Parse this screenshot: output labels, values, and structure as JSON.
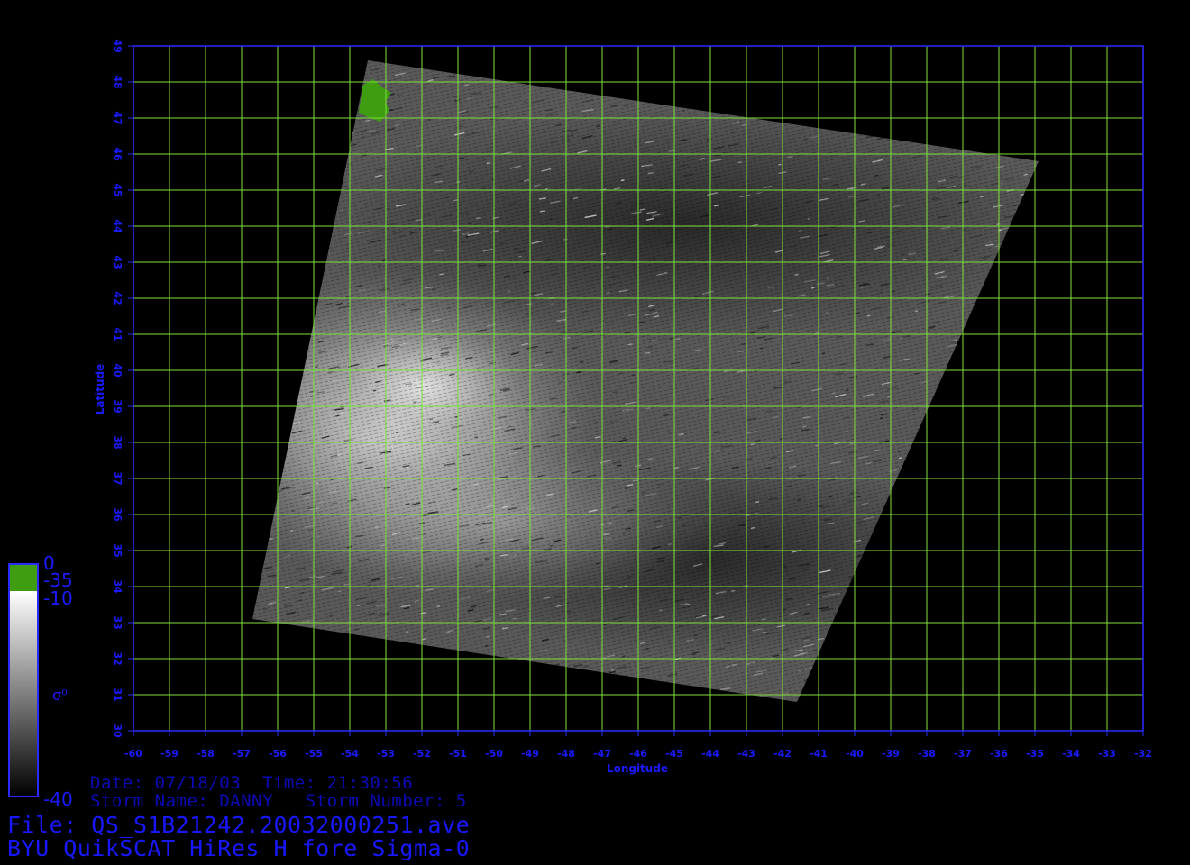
{
  "map": {
    "lon_min": -60,
    "lon_max": -32,
    "lat_min": 30,
    "lat_max": 49,
    "xlabel": "Longitude",
    "ylabel": "Latitude",
    "grid_color": "#7fe03a",
    "frame_color": "#2a2aff",
    "swath_corners_lonlat": [
      [
        -53.5,
        48.6
      ],
      [
        -34.9,
        45.8
      ],
      [
        -41.6,
        30.8
      ],
      [
        -56.7,
        33.1
      ]
    ],
    "land_patch_lonlat": [
      -53.2,
      47.4
    ],
    "land_color": "#3f9d12"
  },
  "colorbar": {
    "label_top": "0",
    "label_green_bottom": "-35",
    "label_gray_top": "-10",
    "label_bottom": "-40",
    "label_sigma": "σ⁰",
    "land_color": "#3f9d12",
    "frame_color": "#2a2aff"
  },
  "info": {
    "date_line": "Date: 07/18/03  Time: 21:30:56",
    "storm_line": "Storm Name: DANNY   Storm Number: 5",
    "file_line": "File: QS_S1B21242.20032000251.ave",
    "title_line": "BYU QuikSCAT HiRes H fore Sigma-0"
  }
}
